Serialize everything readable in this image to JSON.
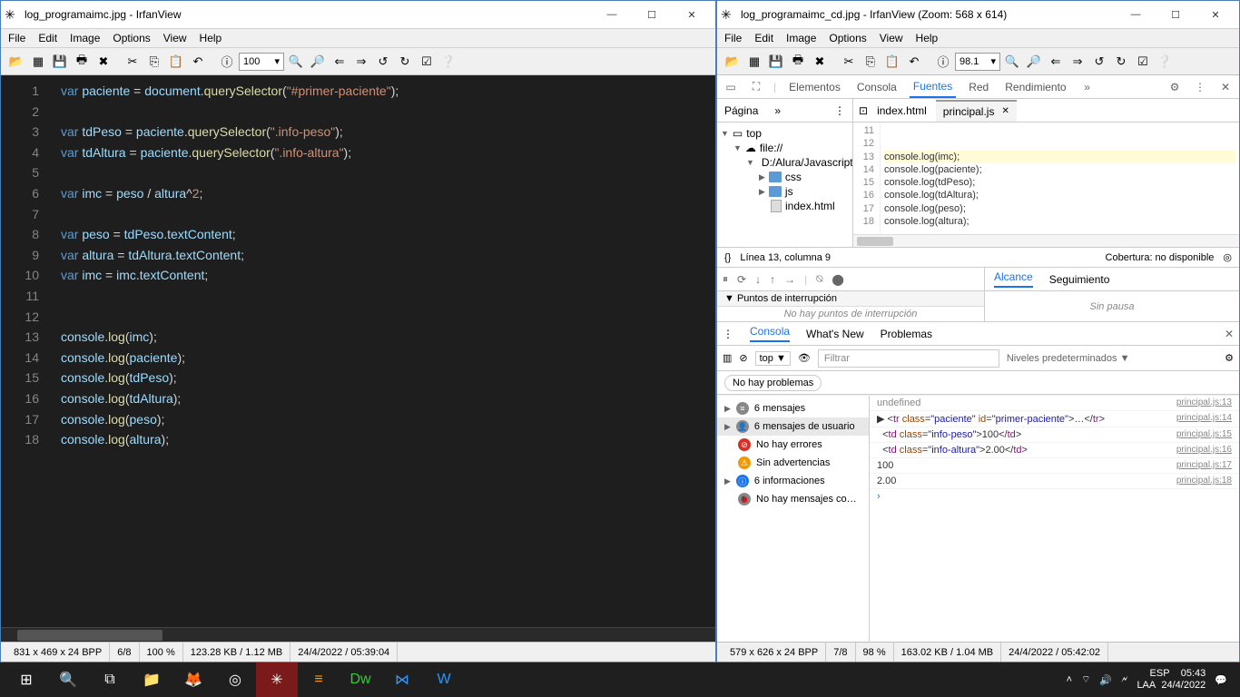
{
  "left_window": {
    "title": "log_programaimc.jpg - IrfanView",
    "menus": [
      "File",
      "Edit",
      "Image",
      "Options",
      "View",
      "Help"
    ],
    "zoom": "100",
    "code_lines": [
      {
        "n": 1,
        "html": "<span class='kw'>var</span> <span class='id'>paciente</span> = <span class='id'>document</span>.<span class='fn'>querySelector</span>(<span class='st'>\"#primer-paciente\"</span>);"
      },
      {
        "n": 2,
        "html": ""
      },
      {
        "n": 3,
        "html": "<span class='kw'>var</span> <span class='id'>tdPeso</span> = <span class='id'>paciente</span>.<span class='fn'>querySelector</span>(<span class='st'>\".info-peso\"</span>);"
      },
      {
        "n": 4,
        "html": "<span class='kw'>var</span> <span class='id'>tdAltura</span> = <span class='id'>paciente</span>.<span class='fn'>querySelector</span>(<span class='st'>\".info-altura\"</span>);"
      },
      {
        "n": 5,
        "html": ""
      },
      {
        "n": 6,
        "html": "<span class='kw'>var</span> <span class='id'>imc</span> = <span class='id'>peso</span> / <span class='id'>altura</span>^<span class='st'>2</span>;"
      },
      {
        "n": 7,
        "html": ""
      },
      {
        "n": 8,
        "html": "<span class='kw'>var</span> <span class='id'>peso</span> = <span class='id'>tdPeso</span>.<span class='id'>textContent</span>;"
      },
      {
        "n": 9,
        "html": "<span class='kw'>var</span> <span class='id'>altura</span> = <span class='id'>tdAltura</span>.<span class='id'>textContent</span>;"
      },
      {
        "n": 10,
        "html": "<span class='kw'>var</span> <span class='id'>imc</span> = <span class='id'>imc</span>.<span class='id'>textContent</span>;"
      },
      {
        "n": 11,
        "html": ""
      },
      {
        "n": 12,
        "html": ""
      },
      {
        "n": 13,
        "html": "<span class='id'>console</span>.<span class='fn'>log</span>(<span class='id'>imc</span>);"
      },
      {
        "n": 14,
        "html": "<span class='id'>console</span>.<span class='fn'>log</span>(<span class='id'>paciente</span>);"
      },
      {
        "n": 15,
        "html": "<span class='id'>console</span>.<span class='fn'>log</span>(<span class='id'>tdPeso</span>);"
      },
      {
        "n": 16,
        "html": "<span class='id'>console</span>.<span class='fn'>log</span>(<span class='id'>tdAltura</span>);"
      },
      {
        "n": 17,
        "html": "<span class='id'>console</span>.<span class='fn'>log</span>(<span class='id'>peso</span>);"
      },
      {
        "n": 18,
        "html": "<span class='id'>console</span>.<span class='fn'>log</span>(<span class='id'>altura</span>);"
      }
    ],
    "status": [
      "831 x 469 x 24 BPP",
      "6/8",
      "100 %",
      "123.28 KB / 1.12 MB",
      "24/4/2022 / 05:39:04"
    ]
  },
  "right_window": {
    "title": "log_programaimc_cd.jpg - IrfanView (Zoom: 568 x 614)",
    "menus": [
      "File",
      "Edit",
      "Image",
      "Options",
      "View",
      "Help"
    ],
    "zoom": "98.1",
    "status": [
      "579 x 626 x 24 BPP",
      "7/8",
      "98 %",
      "163.02 KB / 1.04 MB",
      "24/4/2022 / 05:42:02"
    ],
    "dt_tabs": [
      "Elementos",
      "Consola",
      "Fuentes",
      "Red",
      "Rendimiento"
    ],
    "dt_active_tab": "Fuentes",
    "page_tab": "Página",
    "tree": {
      "top": "top",
      "file": "file://",
      "path": "D:/Alura/Javascript",
      "folders": [
        "css",
        "js"
      ],
      "index": "index.html"
    },
    "file_tabs": [
      {
        "label": "index.html",
        "active": false
      },
      {
        "label": "principal.js",
        "active": true
      }
    ],
    "source_lines": [
      {
        "n": 11,
        "t": "",
        "hl": false
      },
      {
        "n": 12,
        "t": "",
        "hl": false
      },
      {
        "n": 13,
        "t": "console.log(imc);",
        "hl": true
      },
      {
        "n": 14,
        "t": "console.log(paciente);",
        "hl": false
      },
      {
        "n": 15,
        "t": "console.log(tdPeso);",
        "hl": false
      },
      {
        "n": 16,
        "t": "console.log(tdAltura);",
        "hl": false
      },
      {
        "n": 17,
        "t": "console.log(peso);",
        "hl": false
      },
      {
        "n": 18,
        "t": "console.log(altura);",
        "hl": false
      }
    ],
    "cursor_info": "Línea 13, columna 9",
    "coverage": "Cobertura: no disponible",
    "breakpoints_header": "Puntos de interrupción",
    "breakpoints_msg": "No hay puntos de interrupción",
    "scope_tab": "Alcance",
    "watch_tab": "Seguimiento",
    "paused_msg": "Sin pausa",
    "console_tabs": [
      "Consola",
      "What's New",
      "Problemas"
    ],
    "console_top": "top ▼",
    "filter_placeholder": "Filtrar",
    "levels": "Niveles predeterminados ▼",
    "no_problems": "No hay problemas",
    "sidebar_items": [
      {
        "icon": "≡",
        "text": "6 mensajes",
        "expand": true
      },
      {
        "icon": "👤",
        "text": "6 mensajes de usuario",
        "expand": true,
        "sel": true
      },
      {
        "icon": "⊘",
        "text": "No hay errores",
        "color": "c-red"
      },
      {
        "icon": "⚠",
        "text": "Sin advertencias",
        "color": "c-yellow"
      },
      {
        "icon": "ⓘ",
        "text": "6 informaciones",
        "color": "c-blue",
        "expand": true
      },
      {
        "icon": "🐞",
        "text": "No hay mensajes co…"
      }
    ],
    "console_lines": [
      {
        "msg_html": "<span class='und'>undefined</span>",
        "loc": "principal.js:13"
      },
      {
        "msg_html": "▶ &lt;<span class='tag'>tr</span> <span class='attr'>class</span>=<span class='val'>\"paciente\"</span> <span class='attr'>id</span>=<span class='val'>\"primer-paciente\"</span>&gt;…&lt;/<span class='tag'>tr</span>&gt;",
        "loc": "principal.js:14"
      },
      {
        "msg_html": "&nbsp;&nbsp;&lt;<span class='tag'>td</span> <span class='attr'>class</span>=<span class='val'>\"info-peso\"</span>&gt;100&lt;/<span class='tag'>td</span>&gt;",
        "loc": "principal.js:15"
      },
      {
        "msg_html": "&nbsp;&nbsp;&lt;<span class='tag'>td</span> <span class='attr'>class</span>=<span class='val'>\"info-altura\"</span>&gt;2.00&lt;/<span class='tag'>td</span>&gt;",
        "loc": "principal.js:16"
      },
      {
        "msg_html": "100",
        "loc": "principal.js:17"
      },
      {
        "msg_html": "2.00",
        "loc": "principal.js:18"
      }
    ]
  },
  "taskbar": {
    "lang": "ESP",
    "kb": "LAA",
    "time": "05:43",
    "date": "24/4/2022"
  }
}
